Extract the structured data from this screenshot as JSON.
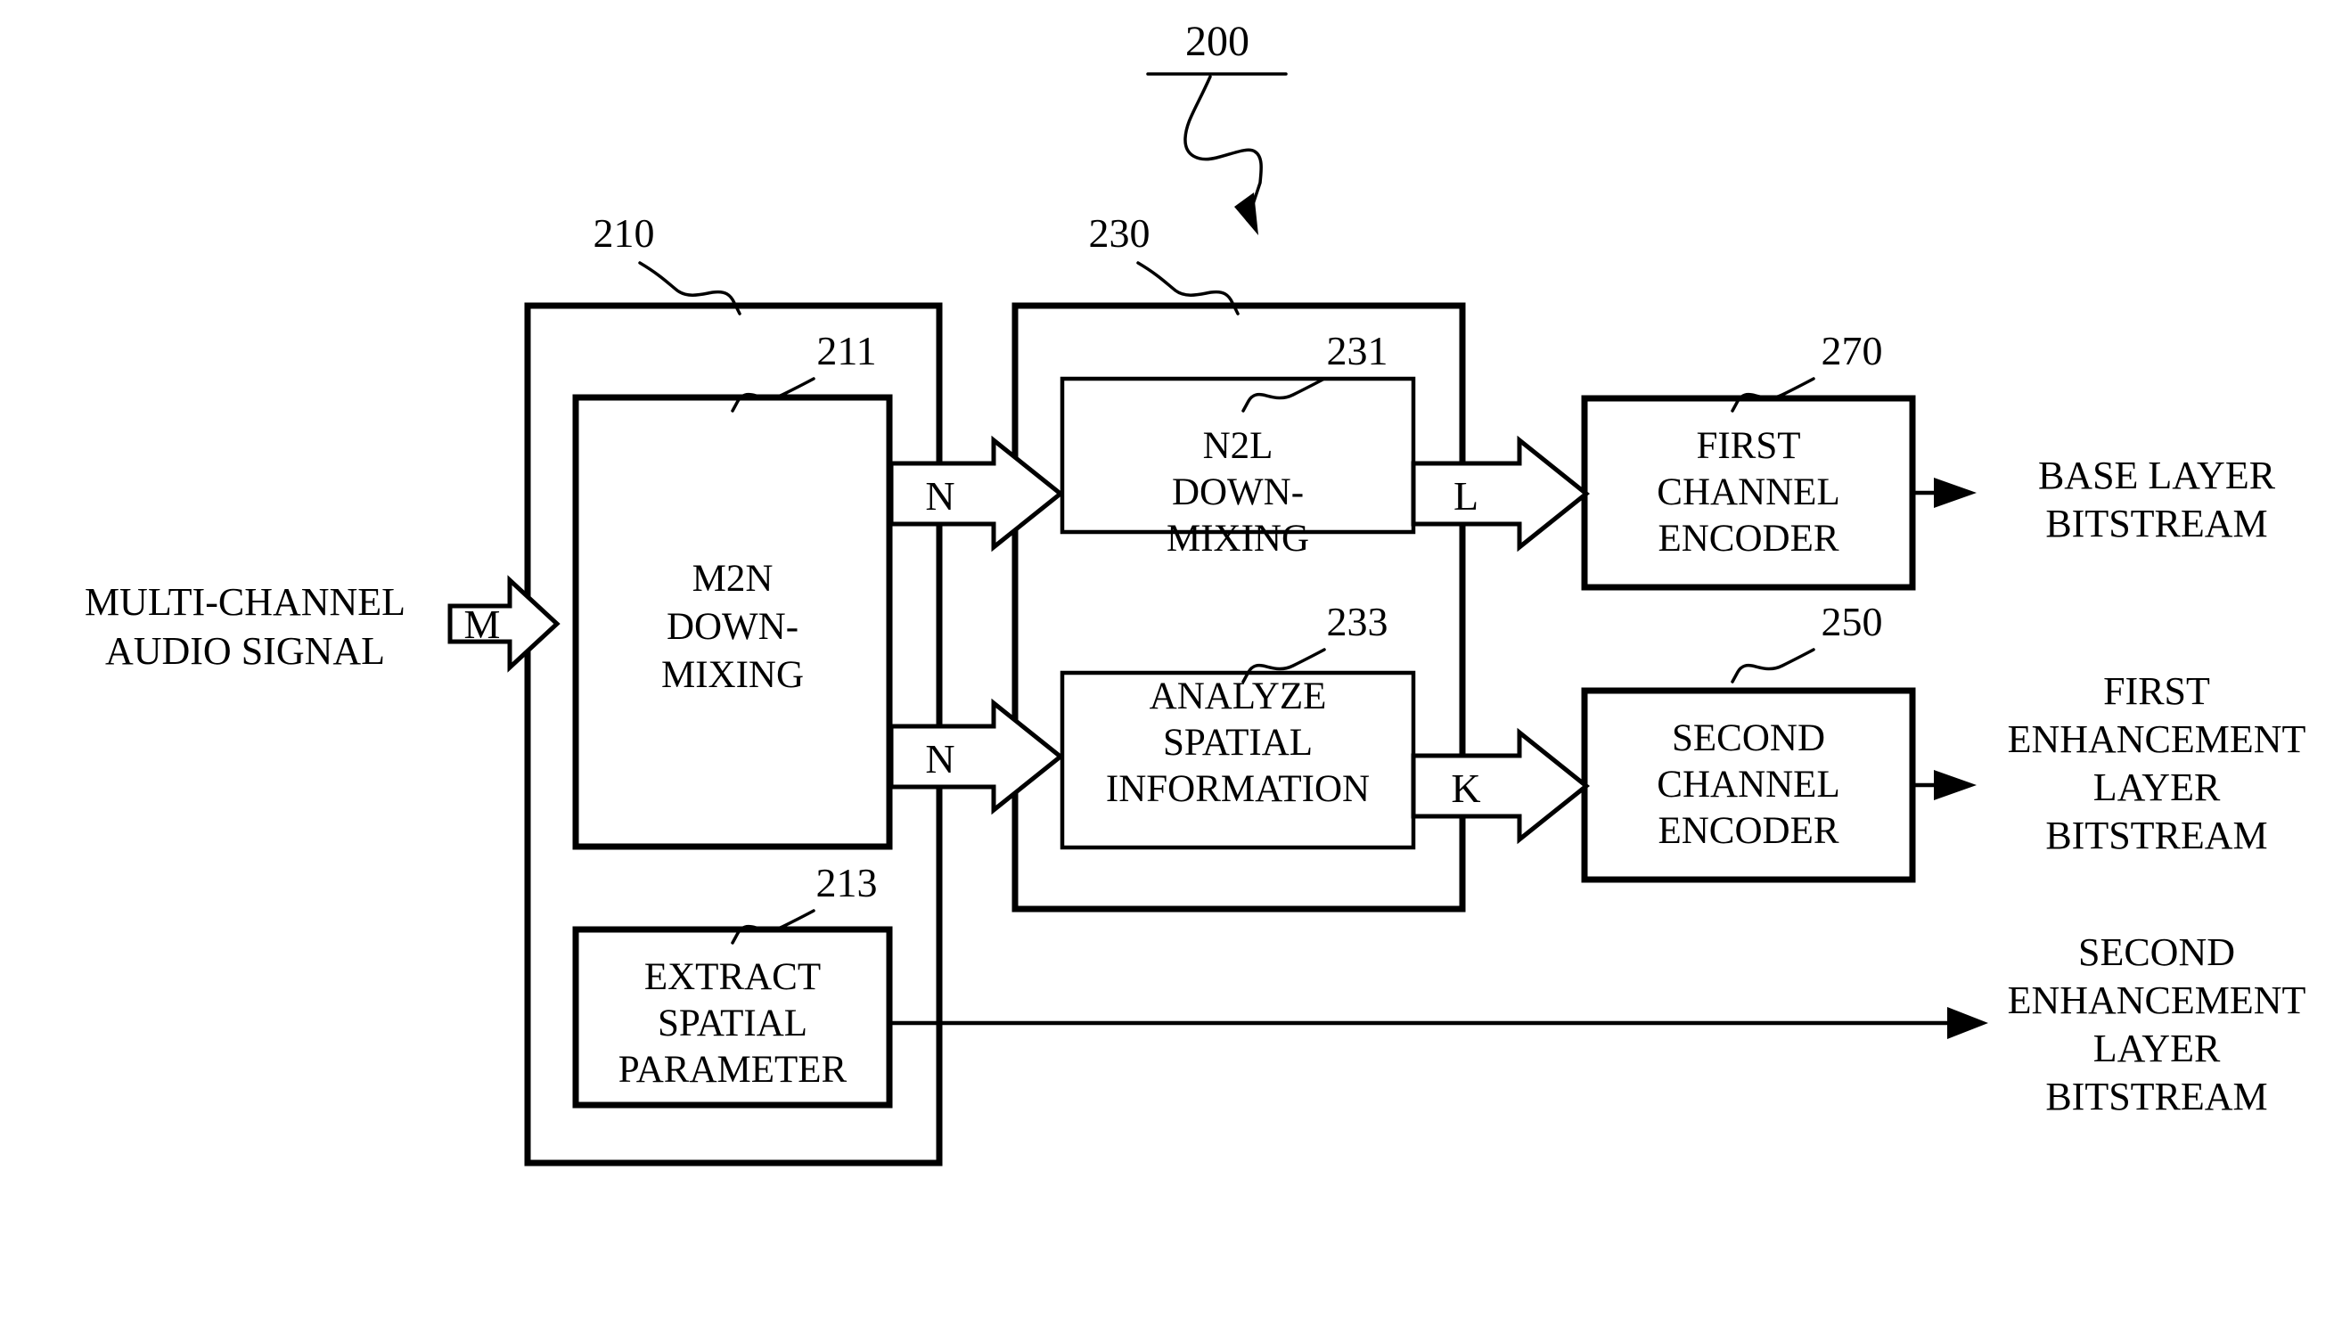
{
  "figure": {
    "reference_numeral": "200",
    "input_label_line1": "MULTI-CHANNEL",
    "input_label_line2": "AUDIO SIGNAL"
  },
  "containers": [
    {
      "ref": "210",
      "name": "downmix-container"
    },
    {
      "ref": "230",
      "name": "spatial-container"
    }
  ],
  "blocks": [
    {
      "ref": "211",
      "name": "m2n-downmixing",
      "lines": [
        "M2N",
        "DOWN-",
        "MIXING"
      ]
    },
    {
      "ref": "213",
      "name": "extract-spatial-parameter",
      "lines": [
        "EXTRACT",
        "SPATIAL",
        "PARAMETER"
      ]
    },
    {
      "ref": "231",
      "name": "n2l-downmixing",
      "lines": [
        "N2L",
        "DOWN-",
        "MIXING"
      ]
    },
    {
      "ref": "233",
      "name": "analyze-spatial-information",
      "lines": [
        "ANALYZE",
        "SPATIAL",
        "INFORMATION"
      ]
    },
    {
      "ref": "270",
      "name": "first-channel-encoder",
      "lines": [
        "FIRST",
        "CHANNEL",
        "ENCODER"
      ]
    },
    {
      "ref": "250",
      "name": "second-channel-encoder",
      "lines": [
        "SECOND",
        "CHANNEL",
        "ENCODER"
      ]
    }
  ],
  "channel_labels": {
    "input_m": "M",
    "n_top": "N",
    "n_bottom": "N",
    "l": "L",
    "k": "K"
  },
  "outputs": [
    {
      "name": "base-layer-bitstream",
      "lines": [
        "BASE LAYER",
        "BITSTREAM"
      ]
    },
    {
      "name": "first-enhancement-layer-bitstream",
      "lines": [
        "FIRST",
        "ENHANCEMENT",
        "LAYER",
        "BITSTREAM"
      ]
    },
    {
      "name": "second-enhancement-layer-bitstream",
      "lines": [
        "SECOND",
        "ENHANCEMENT",
        "LAYER",
        "BITSTREAM"
      ]
    }
  ],
  "colors": {
    "ink": "#000000",
    "paper": "#ffffff"
  }
}
